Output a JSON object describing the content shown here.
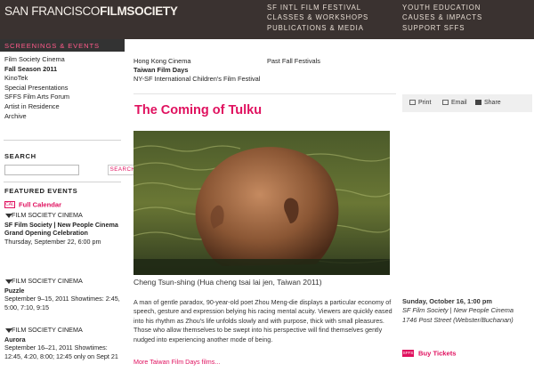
{
  "header": {
    "logo_light": "SAN FRANCISCO",
    "logo_bold": "FILMSOCIETY",
    "nav_col1": [
      "SF Intl Film Festival",
      "Classes & Workshops",
      "Publications & Media"
    ],
    "nav_col2": [
      "Youth Education",
      "Causes & Impacts",
      "Support SFFS"
    ]
  },
  "sidebar": {
    "section_title": "Screenings & Events",
    "items": [
      "Film Society Cinema",
      "Fall Season 2011",
      "KinoTek",
      "Special Presentations",
      "SFFS Film Arts Forum",
      "Artist in Residence",
      "Archive"
    ],
    "search_heading": "Search",
    "search_value": "",
    "search_button": "Search",
    "featured_heading": "Featured Events",
    "calendar_icon_text": "CAL",
    "calendar_link": "Full Calendar",
    "featured": [
      {
        "category": "Film Society Cinema",
        "title": "SF Film Society | New People Cinema Grand Opening Celebration",
        "info": "Thursday, September 22, 6:00 pm"
      },
      {
        "category": "Film Society Cinema",
        "title": "Puzzle",
        "info": "September 9–15, 2011 Showtimes: 2:45, 5:00, 7:10, 9:15"
      },
      {
        "category": "Film Society Cinema",
        "title": "Aurora",
        "info": "September 16–21, 2011 Showtimes: 12:45, 4:20, 8:00; 12:45 only on Sept 21"
      }
    ]
  },
  "subnav": {
    "col1": [
      "Hong Kong Cinema",
      "Taiwan Film Days",
      "NY-SF International Children's Film Festival"
    ],
    "col2": [
      "Past Fall Festivals"
    ]
  },
  "page": {
    "title": "The Coming of Tulku",
    "share": {
      "print": "Print",
      "email": "Email",
      "share": "Share"
    },
    "caption": "Cheng Tsun-shing (Hua cheng tsai lai jen, Taiwan 2011)",
    "description": "A man of gentle paradox, 90-year-old poet Zhou Meng-die displays a particular economy of speech, gesture and expression belying his racing mental acuity. Viewers are quickly eased into his rhythm as Zhou's life unfolds slowly and with purpose, thick with small pleasures. Those who allow themselves to be swept into his perspective will find themselves gently nudged into experiencing another mode of being.",
    "more_link": "More Taiwan Film Days films..."
  },
  "event": {
    "date": "Sunday, October 16, 1:00 pm",
    "venue": "SF Film Society | New People Cinema",
    "address": "1746 Post Street (Webster/Buchanan)",
    "tickets_icon_text": "SFFS",
    "tickets_label": "Buy Tickets"
  }
}
